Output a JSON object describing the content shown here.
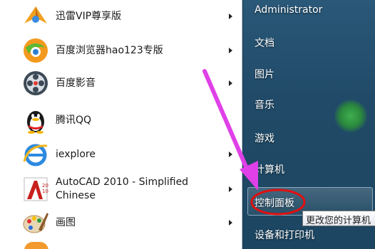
{
  "program_list": [
    {
      "label": "迅雷VIP尊享版",
      "icon": "thunder-bird-icon",
      "has_submenu": true
    },
    {
      "label": "百度浏览器hao123专版",
      "icon": "baidu-browser-icon",
      "has_submenu": true
    },
    {
      "label": "百度影音",
      "icon": "baidu-player-icon",
      "has_submenu": true
    },
    {
      "label": "腾讯QQ",
      "icon": "qq-penguin-icon",
      "has_submenu": false
    },
    {
      "label": "iexplore",
      "icon": "internet-explorer-icon",
      "has_submenu": true
    },
    {
      "label": "AutoCAD 2010 - Simplified Chinese",
      "icon": "autocad-icon",
      "has_submenu": true
    },
    {
      "label": "画图",
      "icon": "paint-palette-icon",
      "has_submenu": true
    }
  ],
  "right_menu": {
    "user": "Administrator",
    "documents": "文档",
    "pictures": "图片",
    "music": "音乐",
    "games": "游戏",
    "computer": "计算机",
    "control_panel": "控制面板",
    "devices": "设备和打印机"
  },
  "tooltip": "更改您的计算机",
  "colors": {
    "annotation_arrow": "#e040e8",
    "annotation_circle": "#e01010",
    "right_pane": "#214a68"
  }
}
